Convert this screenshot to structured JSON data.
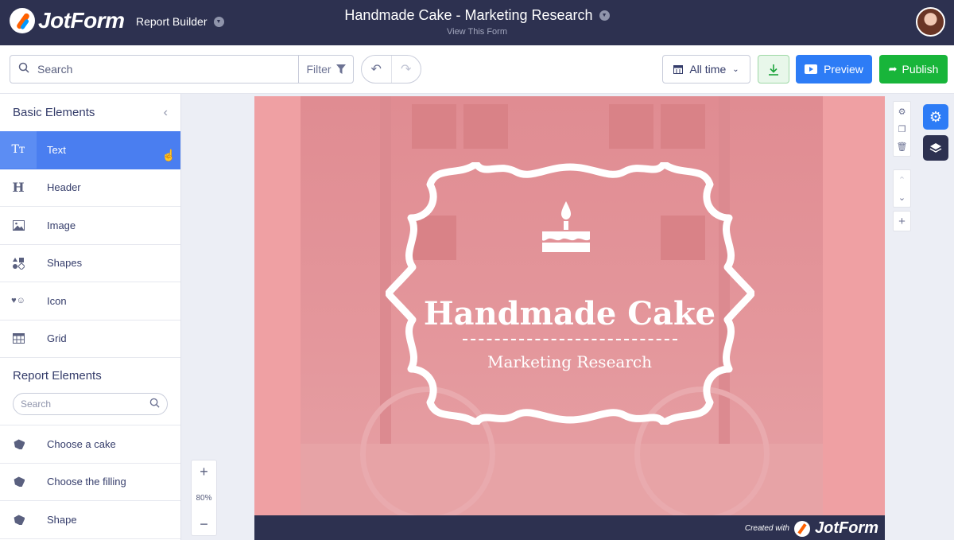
{
  "header": {
    "brand": "JotForm",
    "report_builder_label": "Report Builder",
    "form_title": "Handmade Cake - Marketing Research",
    "view_form_link": "View This Form"
  },
  "toolbar": {
    "search_placeholder": "Search",
    "filter_label": "Filter",
    "date_range": "All time",
    "preview_label": "Preview",
    "publish_label": "Publish"
  },
  "sidebar": {
    "basic_title": "Basic Elements",
    "basic_items": [
      {
        "label": "Text",
        "icon": "text-icon",
        "glyph": "Tт"
      },
      {
        "label": "Header",
        "icon": "header-icon",
        "glyph": "H"
      },
      {
        "label": "Image",
        "icon": "image-icon",
        "glyph": "▣"
      },
      {
        "label": "Shapes",
        "icon": "shapes-icon",
        "glyph": "◆"
      },
      {
        "label": "Icon",
        "icon": "icon-icon",
        "glyph": "♥"
      },
      {
        "label": "Grid",
        "icon": "grid-icon",
        "glyph": "▦"
      }
    ],
    "report_title": "Report Elements",
    "report_search_placeholder": "Search",
    "report_items": [
      {
        "label": "Choose a cake",
        "icon": "tag-icon"
      },
      {
        "label": "Choose the filling",
        "icon": "tag-icon"
      },
      {
        "label": "Shape",
        "icon": "tag-icon"
      }
    ]
  },
  "slide": {
    "title": "Handmade Cake",
    "subtitle": "Marketing Research",
    "footer_created_with": "Created with",
    "footer_brand": "JotForm"
  },
  "zoom": {
    "level": "80%",
    "plus": "+",
    "minus": "−"
  },
  "colors": {
    "topbar": "#2d3150",
    "accent_blue": "#2d7cf6",
    "publish_green": "#18b53a",
    "slide_pink": "#efa0a3",
    "active_item": "#4a7ef0"
  }
}
